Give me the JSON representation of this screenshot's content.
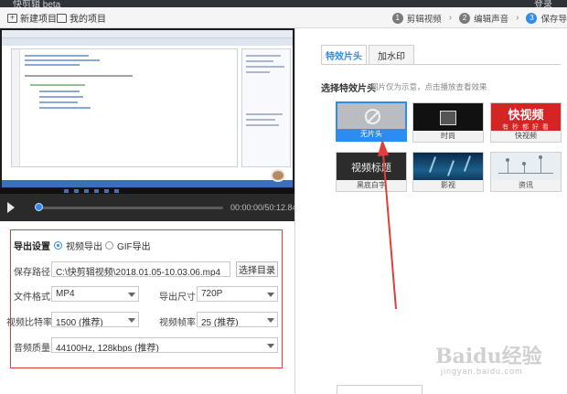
{
  "titlebar": {
    "app_title": "快剪辑 beta",
    "login": "登录"
  },
  "toolbar": {
    "new_project": "新建项目",
    "my_projects": "我的项目",
    "steps": [
      {
        "num": "1",
        "label": "剪辑视频"
      },
      {
        "num": "2",
        "label": "编辑声音"
      },
      {
        "num": "3",
        "label": "保存导"
      }
    ]
  },
  "player": {
    "time": "00:00:00/50:12.84"
  },
  "export": {
    "section_label": "导出设置",
    "radio_video": "视频导出",
    "radio_gif": "GIF导出",
    "save_path_label": "保存路径",
    "save_path_value": "C:\\快剪辑视频\\2018.01.05-10.03.06.mp4",
    "choose_dir": "选择目录",
    "format_label": "文件格式",
    "format_value": "MP4",
    "size_label": "导出尺寸",
    "size_value": "720P",
    "bitrate_label": "视频比特率",
    "bitrate_value": "1500 (推荐)",
    "fps_label": "视频帧率",
    "fps_value": "25 (推荐)",
    "audio_label": "音频质量",
    "audio_value": "44100Hz, 128kbps (推荐)"
  },
  "right": {
    "tab_effects": "特效片头",
    "tab_watermark": "加水印",
    "section_title": "选择特效片头",
    "section_hint": "图片仅为示意，点击播放查看效果",
    "thumbs": [
      {
        "caption": "无片头"
      },
      {
        "caption": "时尚"
      },
      {
        "caption": "快视频",
        "image_text": "快视频",
        "image_sub": "有 秒 都 好 看"
      },
      {
        "caption": "黑底白字",
        "image_text": "视频标题"
      },
      {
        "caption": "影视"
      },
      {
        "caption": "资讯"
      }
    ]
  },
  "watermark": {
    "main": "Baidu经验",
    "sub": "jingyan.baidu.com"
  },
  "colors": {
    "accent": "#2d8cf0",
    "highlight_red": "#e23c3c",
    "dark_bg": "#2a2a2a"
  }
}
